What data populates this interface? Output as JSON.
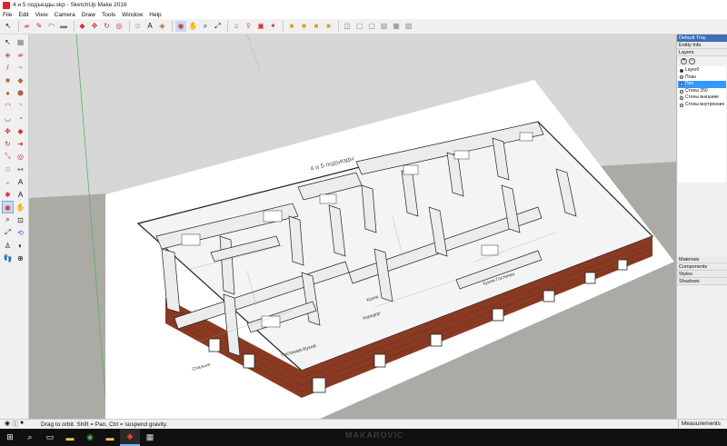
{
  "window": {
    "title": "4 и 5 подъезды.skp - SketchUp Make 2016"
  },
  "menu": [
    "File",
    "Edit",
    "View",
    "Camera",
    "Draw",
    "Tools",
    "Window",
    "Help"
  ],
  "tray": {
    "title": "Default Tray",
    "sections": {
      "entity_info": "Entity Info",
      "layers": "Layers"
    },
    "layers": [
      {
        "name": "Layer0",
        "active": true,
        "selected": false
      },
      {
        "name": "План",
        "active": false,
        "selected": false
      },
      {
        "name": "Пол",
        "active": false,
        "selected": true
      },
      {
        "name": "Стены 250",
        "active": false,
        "selected": false
      },
      {
        "name": "Стены внешние",
        "active": false,
        "selected": false
      },
      {
        "name": "Стены внутренние",
        "active": false,
        "selected": false
      }
    ],
    "bottom_sections": [
      "Materials",
      "Components",
      "Styles",
      "Shadows"
    ]
  },
  "model": {
    "plan_title": "4 и 5 подъезды",
    "room_labels": [
      "Гостиная-Кухня",
      "Спальня",
      "Кухня-Гостиная",
      "Коридор",
      "Кухня"
    ]
  },
  "status": {
    "hint": "Drag to orbit. Shift = Pan, Ctrl = suspend gravity.",
    "measurements_label": "Measurements"
  },
  "watermark": "MAKAROVIC",
  "colors": {
    "accent": "#3d6fb5",
    "selection": "#3399ff",
    "brick": "#8a3a22",
    "sky": "#d4d4d4",
    "ground": "#a9a9a4"
  }
}
